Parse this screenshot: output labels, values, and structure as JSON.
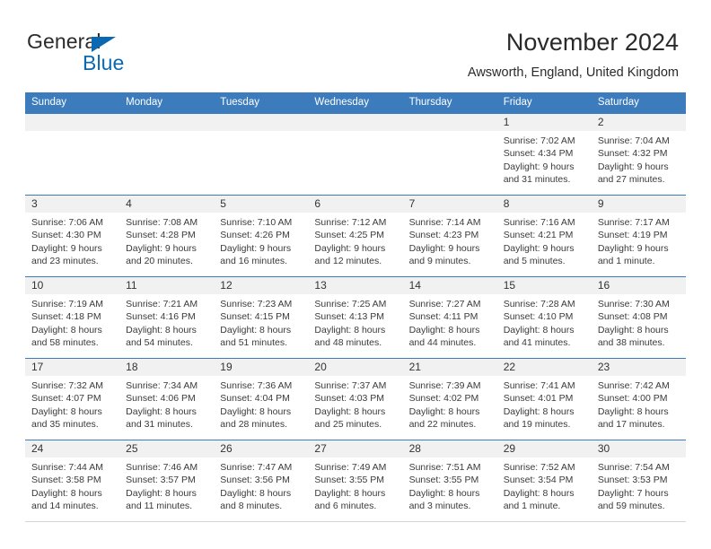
{
  "brand": {
    "name_part1": "General",
    "name_part2": "Blue",
    "triangle_color": "#0b68b1"
  },
  "header": {
    "title": "November 2024",
    "subtitle": "Awsworth, England, United Kingdom"
  },
  "theme": {
    "header_blue": "#3c7cbd",
    "day_band_gray": "#f1f1f1",
    "text": "#333333"
  },
  "weekday_headers": [
    "Sunday",
    "Monday",
    "Tuesday",
    "Wednesday",
    "Thursday",
    "Friday",
    "Saturday"
  ],
  "labels": {
    "sunrise_prefix": "Sunrise:",
    "sunset_prefix": "Sunset:",
    "daylight_prefix": "Daylight:"
  },
  "weeks": [
    [
      {
        "day": "",
        "empty": true
      },
      {
        "day": "",
        "empty": true
      },
      {
        "day": "",
        "empty": true
      },
      {
        "day": "",
        "empty": true
      },
      {
        "day": "",
        "empty": true
      },
      {
        "day": "1",
        "sunrise": "Sunrise: 7:02 AM",
        "sunset": "Sunset: 4:34 PM",
        "daylight_line1": "Daylight: 9 hours",
        "daylight_line2": "and 31 minutes."
      },
      {
        "day": "2",
        "sunrise": "Sunrise: 7:04 AM",
        "sunset": "Sunset: 4:32 PM",
        "daylight_line1": "Daylight: 9 hours",
        "daylight_line2": "and 27 minutes."
      }
    ],
    [
      {
        "day": "3",
        "sunrise": "Sunrise: 7:06 AM",
        "sunset": "Sunset: 4:30 PM",
        "daylight_line1": "Daylight: 9 hours",
        "daylight_line2": "and 23 minutes."
      },
      {
        "day": "4",
        "sunrise": "Sunrise: 7:08 AM",
        "sunset": "Sunset: 4:28 PM",
        "daylight_line1": "Daylight: 9 hours",
        "daylight_line2": "and 20 minutes."
      },
      {
        "day": "5",
        "sunrise": "Sunrise: 7:10 AM",
        "sunset": "Sunset: 4:26 PM",
        "daylight_line1": "Daylight: 9 hours",
        "daylight_line2": "and 16 minutes."
      },
      {
        "day": "6",
        "sunrise": "Sunrise: 7:12 AM",
        "sunset": "Sunset: 4:25 PM",
        "daylight_line1": "Daylight: 9 hours",
        "daylight_line2": "and 12 minutes."
      },
      {
        "day": "7",
        "sunrise": "Sunrise: 7:14 AM",
        "sunset": "Sunset: 4:23 PM",
        "daylight_line1": "Daylight: 9 hours",
        "daylight_line2": "and 9 minutes."
      },
      {
        "day": "8",
        "sunrise": "Sunrise: 7:16 AM",
        "sunset": "Sunset: 4:21 PM",
        "daylight_line1": "Daylight: 9 hours",
        "daylight_line2": "and 5 minutes."
      },
      {
        "day": "9",
        "sunrise": "Sunrise: 7:17 AM",
        "sunset": "Sunset: 4:19 PM",
        "daylight_line1": "Daylight: 9 hours",
        "daylight_line2": "and 1 minute."
      }
    ],
    [
      {
        "day": "10",
        "sunrise": "Sunrise: 7:19 AM",
        "sunset": "Sunset: 4:18 PM",
        "daylight_line1": "Daylight: 8 hours",
        "daylight_line2": "and 58 minutes."
      },
      {
        "day": "11",
        "sunrise": "Sunrise: 7:21 AM",
        "sunset": "Sunset: 4:16 PM",
        "daylight_line1": "Daylight: 8 hours",
        "daylight_line2": "and 54 minutes."
      },
      {
        "day": "12",
        "sunrise": "Sunrise: 7:23 AM",
        "sunset": "Sunset: 4:15 PM",
        "daylight_line1": "Daylight: 8 hours",
        "daylight_line2": "and 51 minutes."
      },
      {
        "day": "13",
        "sunrise": "Sunrise: 7:25 AM",
        "sunset": "Sunset: 4:13 PM",
        "daylight_line1": "Daylight: 8 hours",
        "daylight_line2": "and 48 minutes."
      },
      {
        "day": "14",
        "sunrise": "Sunrise: 7:27 AM",
        "sunset": "Sunset: 4:11 PM",
        "daylight_line1": "Daylight: 8 hours",
        "daylight_line2": "and 44 minutes."
      },
      {
        "day": "15",
        "sunrise": "Sunrise: 7:28 AM",
        "sunset": "Sunset: 4:10 PM",
        "daylight_line1": "Daylight: 8 hours",
        "daylight_line2": "and 41 minutes."
      },
      {
        "day": "16",
        "sunrise": "Sunrise: 7:30 AM",
        "sunset": "Sunset: 4:08 PM",
        "daylight_line1": "Daylight: 8 hours",
        "daylight_line2": "and 38 minutes."
      }
    ],
    [
      {
        "day": "17",
        "sunrise": "Sunrise: 7:32 AM",
        "sunset": "Sunset: 4:07 PM",
        "daylight_line1": "Daylight: 8 hours",
        "daylight_line2": "and 35 minutes."
      },
      {
        "day": "18",
        "sunrise": "Sunrise: 7:34 AM",
        "sunset": "Sunset: 4:06 PM",
        "daylight_line1": "Daylight: 8 hours",
        "daylight_line2": "and 31 minutes."
      },
      {
        "day": "19",
        "sunrise": "Sunrise: 7:36 AM",
        "sunset": "Sunset: 4:04 PM",
        "daylight_line1": "Daylight: 8 hours",
        "daylight_line2": "and 28 minutes."
      },
      {
        "day": "20",
        "sunrise": "Sunrise: 7:37 AM",
        "sunset": "Sunset: 4:03 PM",
        "daylight_line1": "Daylight: 8 hours",
        "daylight_line2": "and 25 minutes."
      },
      {
        "day": "21",
        "sunrise": "Sunrise: 7:39 AM",
        "sunset": "Sunset: 4:02 PM",
        "daylight_line1": "Daylight: 8 hours",
        "daylight_line2": "and 22 minutes."
      },
      {
        "day": "22",
        "sunrise": "Sunrise: 7:41 AM",
        "sunset": "Sunset: 4:01 PM",
        "daylight_line1": "Daylight: 8 hours",
        "daylight_line2": "and 19 minutes."
      },
      {
        "day": "23",
        "sunrise": "Sunrise: 7:42 AM",
        "sunset": "Sunset: 4:00 PM",
        "daylight_line1": "Daylight: 8 hours",
        "daylight_line2": "and 17 minutes."
      }
    ],
    [
      {
        "day": "24",
        "sunrise": "Sunrise: 7:44 AM",
        "sunset": "Sunset: 3:58 PM",
        "daylight_line1": "Daylight: 8 hours",
        "daylight_line2": "and 14 minutes."
      },
      {
        "day": "25",
        "sunrise": "Sunrise: 7:46 AM",
        "sunset": "Sunset: 3:57 PM",
        "daylight_line1": "Daylight: 8 hours",
        "daylight_line2": "and 11 minutes."
      },
      {
        "day": "26",
        "sunrise": "Sunrise: 7:47 AM",
        "sunset": "Sunset: 3:56 PM",
        "daylight_line1": "Daylight: 8 hours",
        "daylight_line2": "and 8 minutes."
      },
      {
        "day": "27",
        "sunrise": "Sunrise: 7:49 AM",
        "sunset": "Sunset: 3:55 PM",
        "daylight_line1": "Daylight: 8 hours",
        "daylight_line2": "and 6 minutes."
      },
      {
        "day": "28",
        "sunrise": "Sunrise: 7:51 AM",
        "sunset": "Sunset: 3:55 PM",
        "daylight_line1": "Daylight: 8 hours",
        "daylight_line2": "and 3 minutes."
      },
      {
        "day": "29",
        "sunrise": "Sunrise: 7:52 AM",
        "sunset": "Sunset: 3:54 PM",
        "daylight_line1": "Daylight: 8 hours",
        "daylight_line2": "and 1 minute."
      },
      {
        "day": "30",
        "sunrise": "Sunrise: 7:54 AM",
        "sunset": "Sunset: 3:53 PM",
        "daylight_line1": "Daylight: 7 hours",
        "daylight_line2": "and 59 minutes."
      }
    ]
  ]
}
